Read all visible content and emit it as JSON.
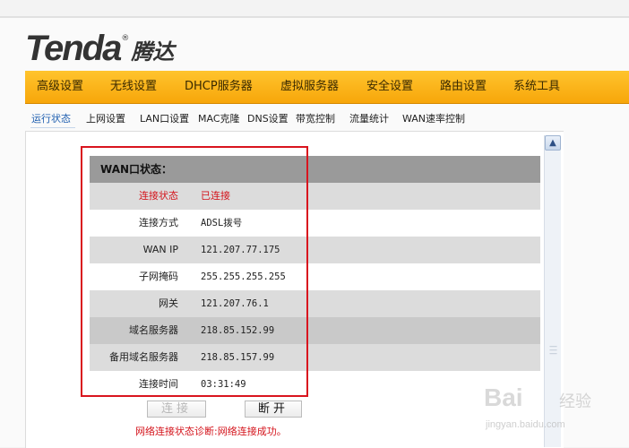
{
  "brand": {
    "name": "Tenda",
    "registered": "®",
    "name_cn": "腾达"
  },
  "main_nav": [
    "高级设置",
    "无线设置",
    "DHCP服务器",
    "虚拟服务器",
    "安全设置",
    "路由设置",
    "系统工具"
  ],
  "sub_nav": {
    "active_index": 0,
    "items": [
      "运行状态",
      "上网设置",
      "LAN口设置",
      "MAC克隆",
      "DNS设置",
      "带宽控制",
      "流量统计",
      "WAN速率控制"
    ]
  },
  "wan_status": {
    "title": "WAN口状态：",
    "rows": [
      {
        "label": "连接状态",
        "value": "已连接",
        "highlight": true
      },
      {
        "label": "连接方式",
        "value": "ADSL拨号"
      },
      {
        "label": "WAN IP",
        "value": "121.207.77.175"
      },
      {
        "label": "子网掩码",
        "value": "255.255.255.255"
      },
      {
        "label": "网关",
        "value": "121.207.76.1"
      },
      {
        "label": "域名服务器",
        "value": "218.85.152.99"
      },
      {
        "label": "备用域名服务器",
        "value": "218.85.157.99"
      },
      {
        "label": "连接时间",
        "value": "03:31:49"
      }
    ]
  },
  "buttons": {
    "connect": "连接",
    "disconnect": "断开"
  },
  "diagnosis": "网络连接状态诊断:网络连接成功。",
  "watermark": {
    "logo": "Bai",
    "cn": "经验",
    "url": "jingyan.baidu.com"
  },
  "colors": {
    "nav_orange": "#f7a60a",
    "highlight_red": "#d4131b",
    "link_blue": "#1f5fb0"
  }
}
